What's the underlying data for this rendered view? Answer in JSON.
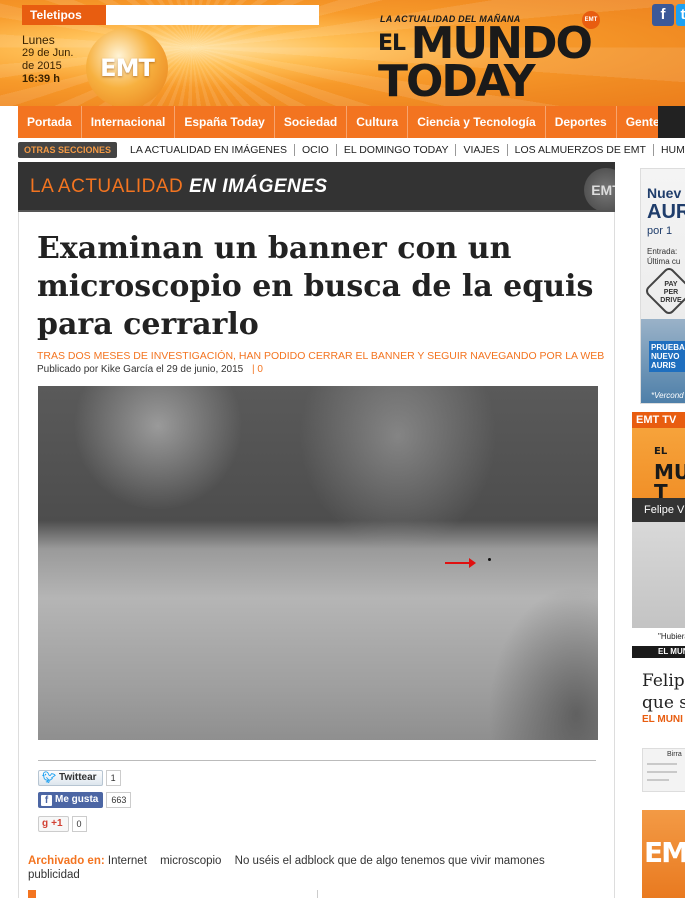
{
  "header": {
    "teletipos_label": "Teletipos",
    "date": {
      "day": "Lunes",
      "date_line1": "29 de Jun.",
      "date_line2": "de 2015",
      "time": "16:39 h"
    },
    "emt_logo_text": "EMT",
    "masthead": {
      "tagline": "LA ACTUALIDAD DEL MAÑANA",
      "el": "EL",
      "mundo": "MUNDO",
      "today": "TODAY",
      "badge": "EMT"
    },
    "social": [
      {
        "icon": "facebook-icon",
        "glyph": "f"
      },
      {
        "icon": "twitter-icon",
        "glyph": "t"
      }
    ]
  },
  "main_nav": [
    "Portada",
    "Internacional",
    "España Today",
    "Sociedad",
    "Cultura",
    "Ciencia y Tecnología",
    "Deportes",
    "Gente"
  ],
  "secondary_nav": {
    "label": "OTRAS SECCIONES",
    "items": [
      "LA ACTUALIDAD EN IMÁGENES",
      "OCIO",
      "EL DOMINGO TODAY",
      "VIAJES",
      "LOS ALMUERZOS DE EMT",
      "HUM"
    ]
  },
  "section_header": {
    "title_light": "LA ACTUALIDAD ",
    "title_bold": "EN IMÁGENES",
    "badge": "EMT"
  },
  "article": {
    "headline": "Examinan un banner con un microscopio en busca de la equis para cerrarlo",
    "subtitle": "TRAS DOS MESES DE INVESTIGACIÓN, HAN PODIDO CERRAR EL BANNER Y SEGUIR NAVEGANDO POR LA WEB",
    "byline": "Publicado por Kike García el 29 de junio, 2015",
    "byline_sep": "| 0",
    "share": {
      "twitter_label": "Twittear",
      "twitter_count": "1",
      "facebook_label": "Me gusta",
      "facebook_count": "663",
      "gplus_label": "+1",
      "gplus_count": "0"
    },
    "archived_label": "Archivado en:",
    "tags": [
      "Internet",
      "microscopio",
      "No uséis el adblock que de algo tenemos que vivir mamones",
      "publicidad"
    ]
  },
  "sidebar": {
    "ad": {
      "line1": "Nuev",
      "line2": "AUR",
      "line3": "por 1",
      "line4a": "Entrada:",
      "line4b": "Última cu",
      "badge_l1": "PAY",
      "badge_l2": "PER",
      "badge_l3": "DRIVE",
      "promo_l1": "PRUEBA",
      "promo_l2": "NUEVO",
      "promo_l3": "AURIS",
      "footnote": "*Vercond"
    },
    "tv": {
      "head": "EMT TV",
      "logo_el": "EL",
      "logo_l1": "MU",
      "logo_l2": "T",
      "bar_text": "Felipe V",
      "quote": "\"Hubiera",
      "strip": "EL MUNI"
    },
    "article_title_l1": "Felip",
    "article_title_l2": "que s",
    "article_category": "EL MUNI",
    "thumb_name": "Birra",
    "thumb2_text": "EM"
  }
}
